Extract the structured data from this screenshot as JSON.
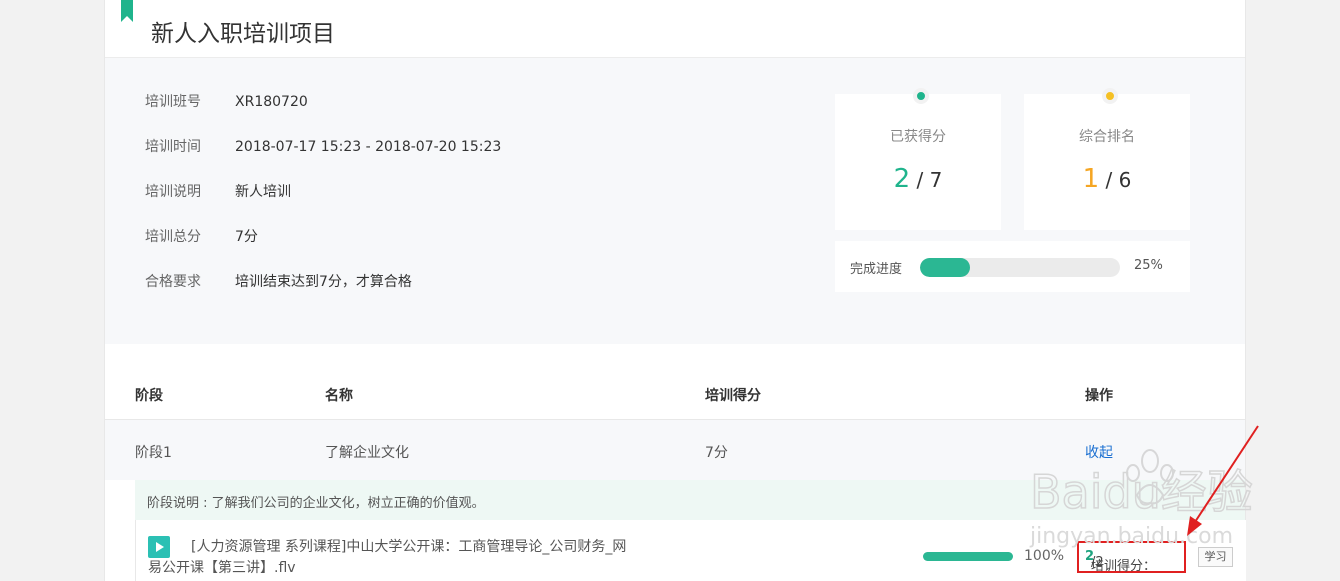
{
  "page": {
    "title": "新人入职培训项目"
  },
  "info": [
    {
      "label": "培训班号",
      "value": "XR180720"
    },
    {
      "label": "培训时间",
      "value": "2018-07-17 15:23 - 2018-07-20 15:23"
    },
    {
      "label": "培训说明",
      "value": "新人培训"
    },
    {
      "label": "培训总分",
      "value": "7分"
    },
    {
      "label": "合格要求",
      "value": "培训结束达到7分，才算合格"
    }
  ],
  "stats": {
    "score": {
      "label": "已获得分",
      "value": "2",
      "total": "/ 7"
    },
    "rank": {
      "label": "综合排名",
      "value": "1",
      "total": "/ 6"
    },
    "progress": {
      "label": "完成进度",
      "percent": 0.25,
      "percent_text": "25%"
    }
  },
  "table": {
    "headers": [
      "阶段",
      "名称",
      "培训得分",
      "操作"
    ],
    "rows": [
      {
        "stage": "阶段1",
        "name": "了解企业文化",
        "score": "7分",
        "action": "收起"
      }
    ],
    "stage_description": "阶段说明 : 了解我们公司的企业文化，树立正确的价值观。"
  },
  "lesson": {
    "title": "[人力资源管理 系列课程]中山大学公开课：工商管理导论_公司财务_网易公开课【第三讲】.flv",
    "progress": 1.0,
    "progress_text": "100%",
    "score_label": "培训得分：",
    "score_value": "2",
    "score_total": "/2",
    "learn_button": "学习"
  },
  "watermark": {
    "text": "Baidu经验",
    "sub": "jingyan.baidu.com"
  },
  "colors": {
    "accent": "#2bb793",
    "score_green": "#1fb48c",
    "rank_orange": "#f5a623",
    "link": "#1a6fd1",
    "highlight_red": "#e02020"
  }
}
